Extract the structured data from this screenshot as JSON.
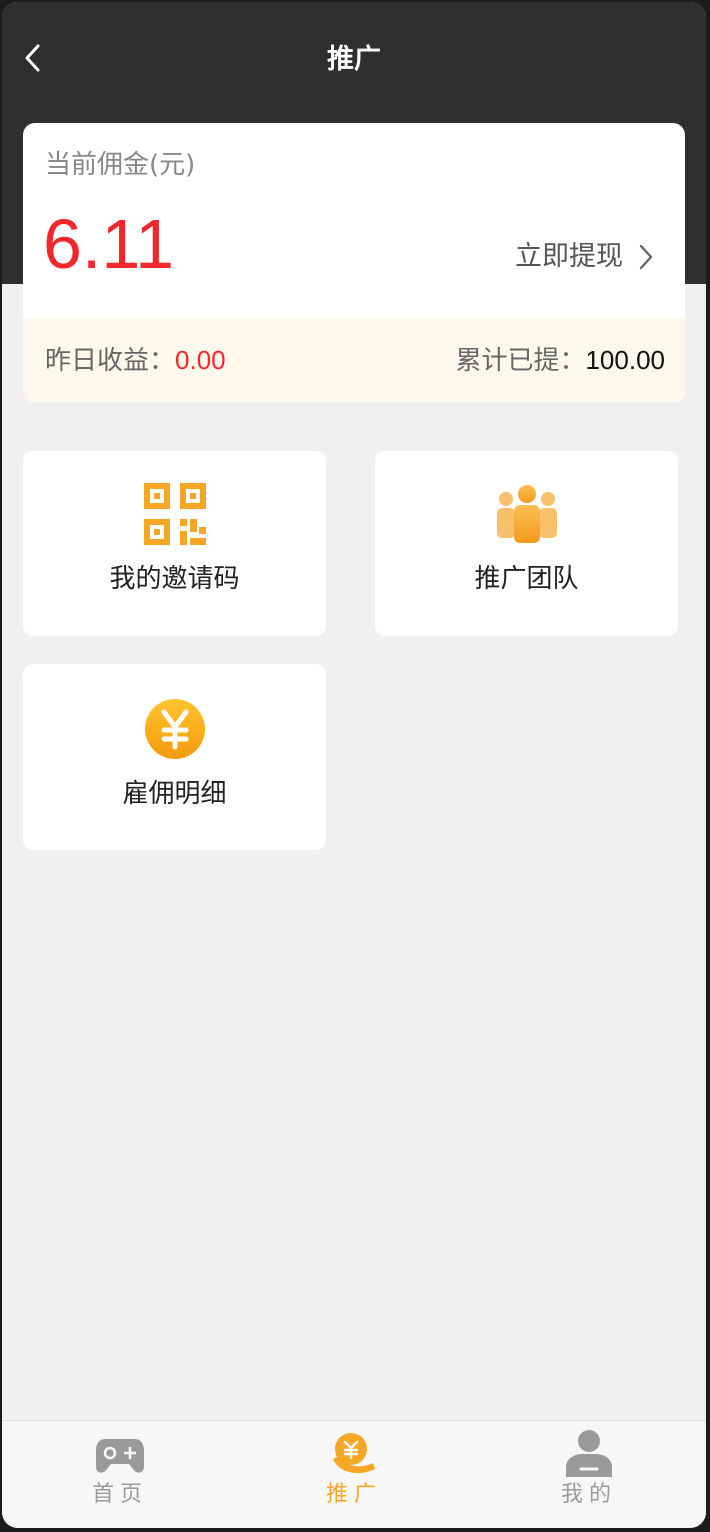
{
  "header": {
    "title": "推广",
    "back_icon": "chevron-left-icon"
  },
  "commission": {
    "label": "当前佣金(元)",
    "amount": "6.11",
    "withdraw_label": "立即提现",
    "yesterday_label": "昨日收益：",
    "yesterday_value": "0.00",
    "total_label": "累计已提：",
    "total_value": "100.00"
  },
  "tiles": [
    {
      "label": "我的邀请码",
      "icon": "qr-code-icon"
    },
    {
      "label": "推广团队",
      "icon": "team-icon"
    },
    {
      "label": "雇佣明细",
      "icon": "yen-coin-icon"
    }
  ],
  "tabbar": {
    "items": [
      {
        "label": "首页",
        "icon": "gamepad-icon",
        "active": false
      },
      {
        "label": "推广",
        "icon": "promote-icon",
        "active": true
      },
      {
        "label": "我的",
        "icon": "user-icon",
        "active": false
      }
    ]
  },
  "colors": {
    "accent": "#f5a623",
    "amount": "#f3262c",
    "header_bg": "#2f2f2f",
    "inactive_tab": "#9a9a9a"
  }
}
